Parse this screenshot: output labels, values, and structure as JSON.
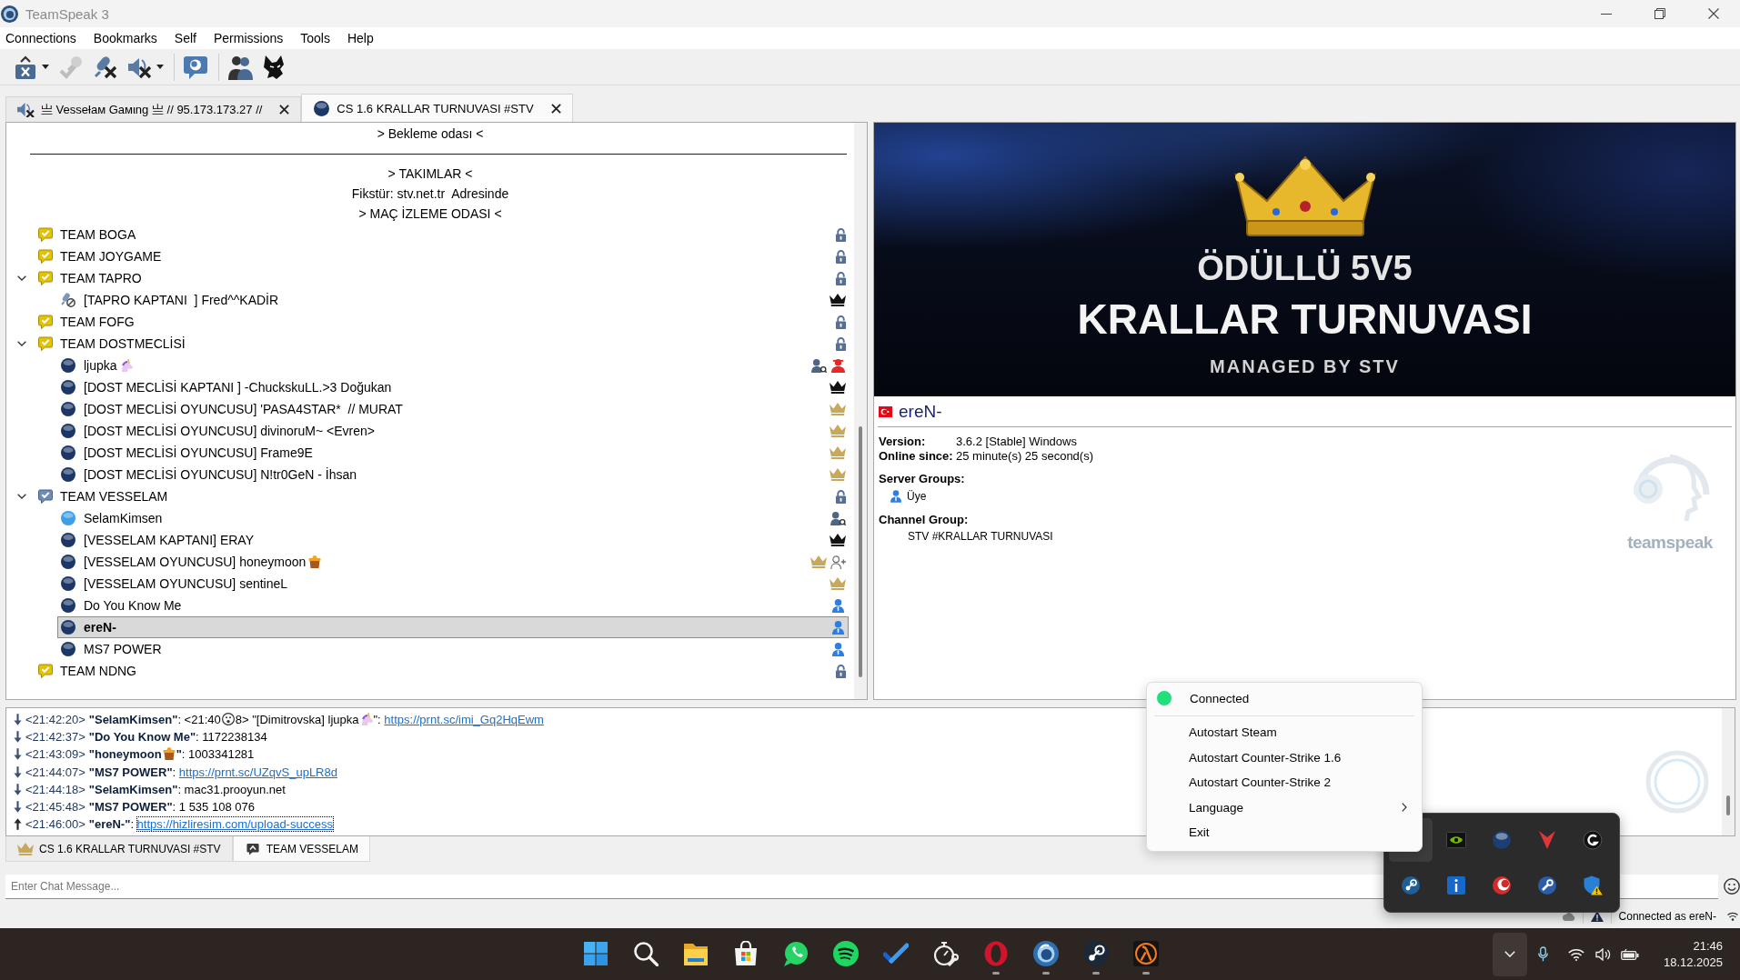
{
  "window": {
    "title": "TeamSpeak 3"
  },
  "menu": [
    "Connections",
    "Bookmarks",
    "Self",
    "Permissions",
    "Tools",
    "Help"
  ],
  "toolbar": [
    {
      "kind": "connect",
      "dropdown": true,
      "disabled": false
    },
    {
      "kind": "disconnect",
      "dropdown": false,
      "disabled": true
    },
    {
      "kind": "mute-microphone",
      "dropdown": false,
      "disabled": false
    },
    {
      "kind": "mute-speakers",
      "dropdown": true,
      "disabled": false
    },
    {
      "kind": "separator"
    },
    {
      "kind": "away",
      "dropdown": false,
      "disabled": false
    },
    {
      "kind": "separator"
    },
    {
      "kind": "contacts",
      "dropdown": false,
      "disabled": false
    },
    {
      "kind": "plugin",
      "dropdown": false,
      "disabled": false
    }
  ],
  "server_tabs": [
    {
      "label": "亗 Vesseƚaм Gaмιng 亗 // 95.173.173.27 //",
      "kind": "muted",
      "selected": false
    },
    {
      "label": "CS 1.6 KRALLAR TURNUVASI #STV",
      "kind": "connected",
      "selected": true
    }
  ],
  "tree": {
    "items": [
      {
        "kind": "spacer",
        "name": "> Bekleme odası <"
      },
      {
        "kind": "divider"
      },
      {
        "kind": "spacer",
        "name": "> TAKIMLAR <"
      },
      {
        "kind": "spacer",
        "name": "Fikstür: stv.net.tr  Adresinde"
      },
      {
        "kind": "spacer",
        "name": "> MAÇ İZLEME ODASI <"
      },
      {
        "kind": "channel",
        "name": "TEAM BOGA",
        "current": false,
        "password": true,
        "expanded": false,
        "selected": false
      },
      {
        "kind": "channel",
        "name": "TEAM JOYGAME",
        "current": false,
        "password": true,
        "expanded": false,
        "selected": false
      },
      {
        "kind": "channel",
        "name": "TEAM TAPRO",
        "current": false,
        "password": true,
        "expanded": true,
        "selected": false,
        "children": [
          {
            "name": "[TAPRO KAPTANI  ] Fred^^KADİR",
            "kind": "mic-off",
            "badges": [
              {
                "kind": "crown-dark"
              }
            ],
            "selected": false
          }
        ]
      },
      {
        "kind": "channel",
        "name": "TEAM FOFG",
        "current": false,
        "password": true,
        "expanded": false,
        "selected": false
      },
      {
        "kind": "channel",
        "name": "TEAM DOSTMECLİSİ",
        "current": false,
        "password": true,
        "expanded": true,
        "selected": false,
        "children": [
          {
            "name": "ljupka",
            "kind": "idle",
            "emoji": {
              "kind": "unicorn"
            },
            "badges": [
              {
                "kind": "user-query"
              },
              {
                "kind": "user-red"
              }
            ],
            "selected": false
          },
          {
            "name": "[DOST MECLİSİ KAPTANI ] -ChuckskuLL.>3 Doğukan",
            "kind": "idle",
            "badges": [
              {
                "kind": "crown-dark"
              }
            ],
            "selected": false
          },
          {
            "name": "[DOST MECLİSİ OYUNCUSU] 'PASA4STAR*  // MURAT",
            "kind": "idle",
            "badges": [
              {
                "kind": "crown-gold"
              }
            ],
            "selected": false
          },
          {
            "name": "[DOST MECLİSİ OYUNCUSU] divinoruM~ <Evren>",
            "kind": "idle",
            "badges": [
              {
                "kind": "crown-gold"
              }
            ],
            "selected": false
          },
          {
            "name": "[DOST MECLİSİ OYUNCUSU] Frame9E",
            "kind": "idle",
            "badges": [
              {
                "kind": "crown-gold"
              }
            ],
            "selected": false
          },
          {
            "name": "[DOST MECLİSİ OYUNCUSU] N!tr0GeN - İhsan",
            "kind": "idle",
            "badges": [
              {
                "kind": "crown-gold"
              }
            ],
            "selected": false
          }
        ]
      },
      {
        "kind": "channel",
        "name": "TEAM VESSELAM",
        "current": true,
        "password": true,
        "expanded": true,
        "selected": false,
        "children": [
          {
            "name": "SelamKimsen",
            "kind": "talking",
            "badges": [
              {
                "kind": "user-query"
              }
            ],
            "selected": false
          },
          {
            "name": "[VESSELAM KAPTANI] ERAY",
            "kind": "idle",
            "badges": [
              {
                "kind": "crown-dark"
              }
            ],
            "selected": false
          },
          {
            "name": "[VESSELAM OYUNCUSU] honeymoon",
            "kind": "idle",
            "emoji": {
              "kind": "honeypot"
            },
            "badges": [
              {
                "kind": "crown-gold"
              },
              {
                "kind": "user-add"
              }
            ],
            "selected": false
          },
          {
            "name": "[VESSELAM OYUNCUSU] sentineL",
            "kind": "idle",
            "badges": [
              {
                "kind": "crown-gold"
              }
            ],
            "selected": false
          },
          {
            "name": "Do You Know Me",
            "kind": "idle",
            "badges": [
              {
                "kind": "user-blue"
              }
            ],
            "selected": false
          },
          {
            "name": "ereN-",
            "kind": "idle",
            "badges": [
              {
                "kind": "user-blue"
              }
            ],
            "selected": true
          },
          {
            "name": "MS7 POWER",
            "kind": "idle",
            "badges": [
              {
                "kind": "user-blue"
              }
            ],
            "selected": false
          }
        ]
      },
      {
        "kind": "channel",
        "name": "TEAM NDNG",
        "current": false,
        "password": true,
        "expanded": false,
        "selected": false
      }
    ]
  },
  "banner": {
    "title": "ÖDÜLLÜ 5V5",
    "subtitle": "KRALLAR TURNUVASI",
    "tagline": "MANAGED BY STV"
  },
  "client_info": {
    "nickname": "ereN-",
    "fields": [
      {
        "label": "Version:",
        "value": "3.6.2 [Stable] Windows"
      },
      {
        "label": "Online since:",
        "value": "25 minute(s) 25 second(s)"
      }
    ],
    "server_groups": {
      "label": "Server Groups:",
      "items": [
        "Üye"
      ]
    },
    "channel_group": {
      "label": "Channel Group:",
      "value": "STV #KRALLAR TURNUVASI"
    },
    "watermark": "teamspeak"
  },
  "chat": {
    "messages": [
      {
        "kind": "incoming",
        "time": "<21:42:20>",
        "parts": [
          {
            "kind": "bold",
            "text": "\"SelamKimsen\""
          },
          {
            "kind": "text",
            "text": ": <21:40"
          },
          {
            "kind": "surprised"
          },
          {
            "kind": "text",
            "text": "8> \"[Dimitrovska] ljupka"
          },
          {
            "kind": "unicorn"
          },
          {
            "kind": "text",
            "text": "\": "
          },
          {
            "kind": "link",
            "text": "https://prnt.sc/imi_Gq2HqEwm",
            "focused": false
          }
        ]
      },
      {
        "kind": "incoming",
        "time": "<21:42:37>",
        "parts": [
          {
            "kind": "bold",
            "text": "\"Do You Know Me\""
          },
          {
            "kind": "text",
            "text": ": 1172238134"
          }
        ]
      },
      {
        "kind": "incoming",
        "time": "<21:43:09>",
        "parts": [
          {
            "kind": "bold",
            "text": "\"honeymoon"
          },
          {
            "kind": "honeypot"
          },
          {
            "kind": "bold",
            "text": "\""
          },
          {
            "kind": "text",
            "text": ": 1003341281"
          }
        ]
      },
      {
        "kind": "incoming",
        "time": "<21:44:07>",
        "parts": [
          {
            "kind": "bold",
            "text": "\"MS7 POWER\""
          },
          {
            "kind": "text",
            "text": ": "
          },
          {
            "kind": "link",
            "text": "https://prnt.sc/UZqvS_upLR8d",
            "focused": false
          }
        ]
      },
      {
        "kind": "incoming",
        "time": "<21:44:18>",
        "parts": [
          {
            "kind": "bold",
            "text": "\"SelamKimsen\""
          },
          {
            "kind": "text",
            "text": ": mac31.prooyun.net"
          }
        ]
      },
      {
        "kind": "incoming",
        "time": "<21:45:48>",
        "parts": [
          {
            "kind": "bold",
            "text": "\"MS7 POWER\""
          },
          {
            "kind": "text",
            "text": ": 1 535 108 076"
          }
        ]
      },
      {
        "kind": "outgoing",
        "time": "<21:46:00>",
        "parts": [
          {
            "kind": "bold",
            "text": "\"ereN-\""
          },
          {
            "kind": "text",
            "text": ": "
          },
          {
            "kind": "link",
            "text": "https://hizliresim.com/upload-success",
            "focused": true
          }
        ]
      }
    ],
    "tabs": [
      {
        "label": "CS 1.6 KRALLAR TURNUVASI #STV",
        "kind": "server",
        "selected": false
      },
      {
        "label": "TEAM VESSELAM",
        "kind": "channel",
        "selected": true
      }
    ],
    "input": {
      "placeholder": "Enter Chat Message..."
    }
  },
  "status_bar": {
    "text": "Connected as ereN-"
  },
  "context_menu": {
    "status": {
      "label": "Connected",
      "connected": true
    },
    "items": [
      {
        "label": "Autostart Steam",
        "submenu": false
      },
      {
        "label": "Autostart Counter-Strike 1.6",
        "submenu": false
      },
      {
        "label": "Autostart Counter-Strike 2",
        "submenu": false
      },
      {
        "label": "Language",
        "submenu": true
      },
      {
        "label": "Exit",
        "submenu": false
      }
    ]
  },
  "tray_overflow": {
    "items": [
      {
        "kind": "empty",
        "hovered": true
      },
      {
        "kind": "chip",
        "hovered": false
      },
      {
        "kind": "sphere",
        "hovered": false
      },
      {
        "kind": "v-mark",
        "hovered": false
      },
      {
        "kind": "g-ring",
        "hovered": false
      },
      {
        "kind": "steam",
        "hovered": false
      },
      {
        "kind": "info",
        "hovered": false
      },
      {
        "kind": "crescent",
        "hovered": false
      },
      {
        "kind": "wrench",
        "hovered": false
      },
      {
        "kind": "shield-warning",
        "hovered": false
      }
    ]
  },
  "taskbar": {
    "apps": [
      {
        "kind": "start",
        "running": false
      },
      {
        "kind": "search",
        "running": false
      },
      {
        "kind": "folder",
        "running": false
      },
      {
        "kind": "store",
        "running": false
      },
      {
        "kind": "chat",
        "running": false
      },
      {
        "kind": "music",
        "running": false
      },
      {
        "kind": "tasks",
        "running": false
      },
      {
        "kind": "tools",
        "running": false
      },
      {
        "kind": "browser",
        "running": true
      },
      {
        "kind": "voice",
        "running": true
      },
      {
        "kind": "games",
        "running": true
      },
      {
        "kind": "lambda",
        "running": true
      }
    ],
    "overflow_open": true,
    "clock": {
      "time": "21:46",
      "date": "18.12.2025"
    }
  }
}
